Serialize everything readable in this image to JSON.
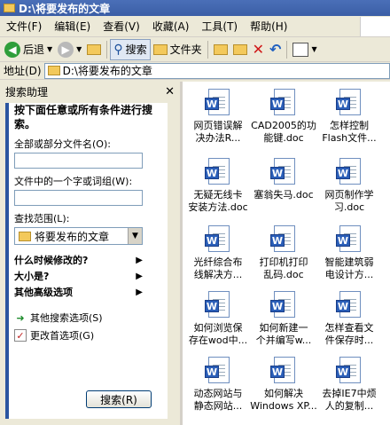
{
  "window": {
    "title": "D:\\将要发布的文章"
  },
  "menu": [
    "文件(F)",
    "编辑(E)",
    "查看(V)",
    "收藏(A)",
    "工具(T)",
    "帮助(H)"
  ],
  "toolbar": {
    "back_label": "后退",
    "search_label": "搜索",
    "folders_label": "文件夹"
  },
  "address": {
    "label": "地址(D)",
    "value": "D:\\将要发布的文章"
  },
  "search_panel": {
    "title": "搜索助理",
    "intro": "按下面任意或所有条件进行搜索。",
    "name_label": "全部或部分文件名(O):",
    "name_value": "",
    "phrase_label": "文件中的一个字或词组(W):",
    "phrase_value": "",
    "lookin_label": "查找范围(L):",
    "lookin_value": "将要发布的文章",
    "options": [
      "什么时候修改的?",
      "大小是?",
      "其他高级选项"
    ],
    "links": [
      "其他搜索选项(S)",
      "更改首选项(G)"
    ],
    "search_button": "搜索(R)"
  },
  "files": [
    {
      "line1": "网页错误解",
      "line2": "决办法R..."
    },
    {
      "line1": "CAD2005的功",
      "line2": "能键.doc"
    },
    {
      "line1": "怎样控制",
      "line2": "Flash文件..."
    },
    {
      "line1": "无疑无线卡",
      "line2": "安装方法.doc"
    },
    {
      "line1": "塞翁失马.doc",
      "line2": ""
    },
    {
      "line1": "网页制作学",
      "line2": "习.doc"
    },
    {
      "line1": "光纤综合布",
      "line2": "线解决方..."
    },
    {
      "line1": "打印机打印",
      "line2": "乱码.doc"
    },
    {
      "line1": "智能建筑弱",
      "line2": "电设计方..."
    },
    {
      "line1": "如何浏览保",
      "line2": "存在wod中..."
    },
    {
      "line1": "如何新建一",
      "line2": "个并编写w..."
    },
    {
      "line1": "怎样查看文",
      "line2": "件保存时..."
    },
    {
      "line1": "动态网站与",
      "line2": "静态网站..."
    },
    {
      "line1": "如何解决",
      "line2": "Windows XP..."
    },
    {
      "line1": "去掉IE7中烦",
      "line2": "人的复制..."
    }
  ]
}
